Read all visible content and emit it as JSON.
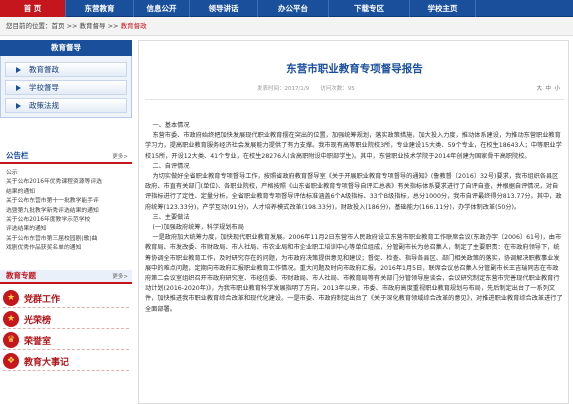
{
  "nav": [
    "首 页",
    "东营教育",
    "信息公开",
    "领导讲话",
    "办公平台",
    "下载专区",
    "学校主页"
  ],
  "breadcrumb": {
    "prefix": "您目前的位置：首页 >> 教育督导 >> ",
    "current": "教育督政"
  },
  "sidebar": {
    "title": "教育督导",
    "items": [
      {
        "label": "教育督政"
      },
      {
        "label": "学校督导"
      },
      {
        "label": "政策法规"
      }
    ]
  },
  "notice": {
    "title": "公告栏",
    "more": "更多>",
    "lines": [
      "公示",
      "关于公布2016年优秀课程资源等评选",
      "结果的通知",
      "关于公布东营市第十一批教学能手评",
      "选暨第九批教学新秀评选结果的通知",
      "关于公布2016年度教学示范学校",
      "评选结果的通知",
      "关于公布东营市第三届校园剧(歌)曲",
      "戏剧优秀作品获奖名单的通知"
    ]
  },
  "special": {
    "title": "教育专题",
    "more": "更多>",
    "items": [
      {
        "label": "党群工作"
      },
      {
        "label": "光荣榜"
      },
      {
        "label": "荣誉室"
      },
      {
        "label": "教育大事记"
      }
    ]
  },
  "article": {
    "title": "东营市职业教育专项督导报告",
    "meta": "发表时间：2017/1/9　　访问次数：95",
    "font_sizes": [
      "大",
      "中",
      "小"
    ],
    "paragraphs": [
      {
        "type": "h",
        "text": "一、基本情况"
      },
      {
        "type": "p",
        "text": "东营市委、市政府始终把加快发展现代职业教育摆在突出的位置，加强统筹规划，落实政策措施，加大投入力度，推动体系建设，为推动东营职业教育学习力，提高职业教育服务经济社会发展能力提供了有力支撑。我市现有高等职业院校3所，专业建设15大类、59个专业，在校生18643人；中等职业学校15所，开设12大类、41个专业，在校生28276人(含高职附设中职部学生)。其中，东营职业技术学院于2014年创建为国家骨干高职院校。"
      },
      {
        "type": "h",
        "text": "二、自评情况"
      },
      {
        "type": "p",
        "text": "为切实做好全省职业教育专项督导工作，按照省政府教育督导室《关于开展职业教育专项督导的通知》(鲁教督〔2016〕32号)要求，我市组织各县区政府、市直有关部门(单位)、各职业院校，严格按照《山东省职业教育专项督导自评汇总表》有关指标体系要求进行了自评自查，并根据自评情况，对自评指标进行了定性、定量分析，全省职业教育专项督导评估标准涵盖6个A级指标、33个B级指标，总分1000分，我市自评最终得分813.77分。其中，政府统筹(123.33分)，产学互动(91分)，人才培养模式改革(198.33分)，财政投入(186分)，基础能力(166.11分)，办学体制改革(50分)。"
      },
      {
        "type": "h",
        "text": "三、主要做法"
      },
      {
        "type": "h",
        "text": "(一)加强政府统筹，科学规划布局"
      },
      {
        "type": "p",
        "text": "一是政府加大统筹力度，加快现代职业教育发展。2006年11月2日东营市人民政府设立东营市职业教育工作联席会议(东政办字〔2006〕61号)，由市教育局、市发改委、市财政局、市人社局、市农业局和市企业职工培训中心等单位组成，分管副市长为总召集人，制定了主要职责：在市政府领导下，统筹协调全市职业教育工作，及时研究存在的问题，为市政府决策提供意见和建议；督促、检查、指导各县区、部门相关政策的落实，协调解决职教事业发展中的难点问题，定期向市政府汇报职业教育工作情况。重大问题及时向市政府汇报。2016年1月5日，联席会议总召集人分管副市长王吉瑞同志在市政府第二会议室组织召开市政府研究室、市经信委、市财政局、市人社局、市教育局等有关部门分管领导座谈会，会议研究制定东营市完善现代职业教育行动计划(2016-2020年)》，为我市职业教育科学发展指明了方向。2013年以来，市委、市政府高度重视职业教育规划与布局，先后制定出台了一系列文件，加快推进我市职业教育综合改革和现代化建设。一是市委、市政府制定出台了《关于深化教育领域综合改革的意见》，对推进职业教育综合改革进行了全面部署。"
      }
    ]
  }
}
